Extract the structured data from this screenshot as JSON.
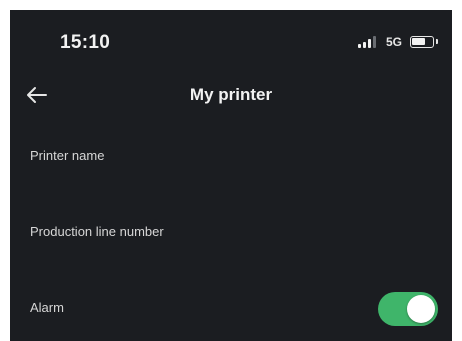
{
  "status_bar": {
    "time": "15:10",
    "network": "5G"
  },
  "header": {
    "title": "My printer"
  },
  "settings": {
    "printer_name_label": "Printer name",
    "production_line_label": "Production line number",
    "alarm_label": "Alarm",
    "alarm_enabled": true
  },
  "colors": {
    "background": "#1b1d21",
    "toggle_on": "#3fb56a",
    "text": "#f2f2f2"
  },
  "icons": [
    "back-arrow-icon",
    "signal-icon",
    "battery-icon"
  ]
}
